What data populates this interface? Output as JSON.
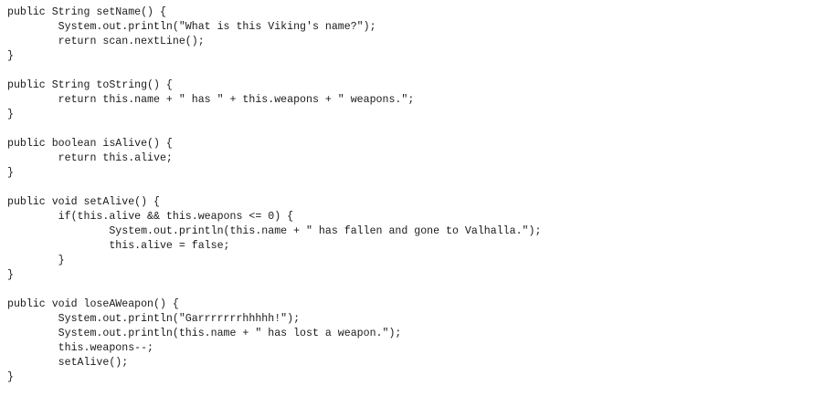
{
  "code": {
    "lines": [
      "public String setName() {",
      "        System.out.println(\"What is this Viking's name?\");",
      "        return scan.nextLine();",
      "}",
      "",
      "public String toString() {",
      "        return this.name + \" has \" + this.weapons + \" weapons.\";",
      "}",
      "",
      "public boolean isAlive() {",
      "        return this.alive;",
      "}",
      "",
      "public void setAlive() {",
      "        if(this.alive && this.weapons <= 0) {",
      "                System.out.println(this.name + \" has fallen and gone to Valhalla.\");",
      "                this.alive = false;",
      "        }",
      "}",
      "",
      "public void loseAWeapon() {",
      "        System.out.println(\"Garrrrrrrhhhhh!\");",
      "        System.out.println(this.name + \" has lost a weapon.\");",
      "        this.weapons--;",
      "        setAlive();",
      "}"
    ]
  }
}
